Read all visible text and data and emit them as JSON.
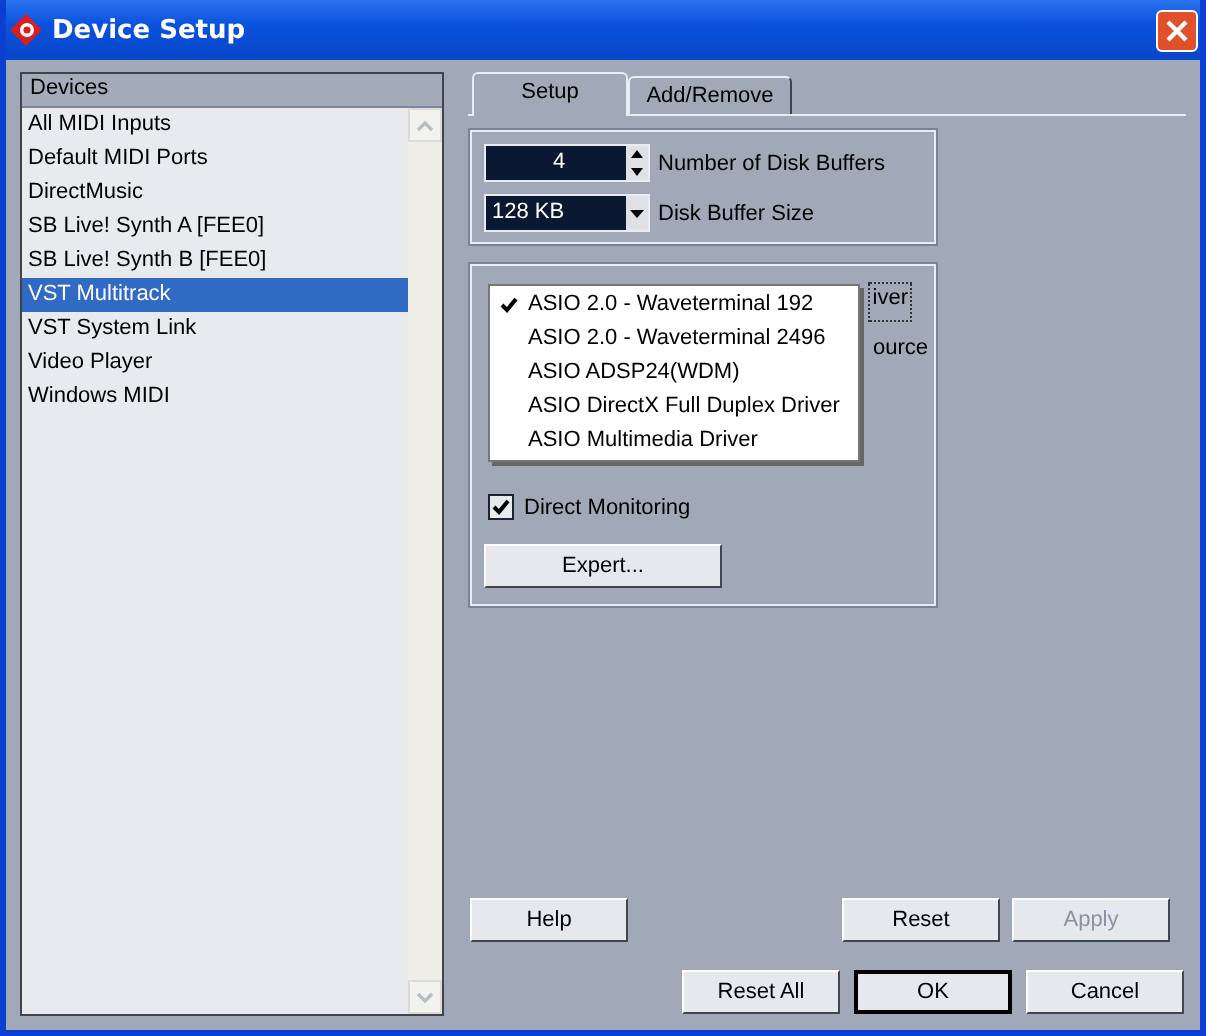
{
  "window": {
    "title": "Device Setup"
  },
  "devices": {
    "header": "Devices",
    "items": [
      {
        "label": "All MIDI Inputs",
        "selected": false
      },
      {
        "label": "Default MIDI Ports",
        "selected": false
      },
      {
        "label": "DirectMusic",
        "selected": false
      },
      {
        "label": "SB Live! Synth A [FEE0]",
        "selected": false
      },
      {
        "label": "SB Live! Synth B [FEE0]",
        "selected": false
      },
      {
        "label": "VST Multitrack",
        "selected": true
      },
      {
        "label": "VST System Link",
        "selected": false
      },
      {
        "label": "Video Player",
        "selected": false
      },
      {
        "label": "Windows MIDI",
        "selected": false
      }
    ]
  },
  "tabs": [
    {
      "label": "Setup",
      "selected": true
    },
    {
      "label": "Add/Remove",
      "selected": false
    }
  ],
  "disk_buffers": {
    "value": "4",
    "label": "Number of Disk Buffers"
  },
  "buffer_size": {
    "value": "128 KB",
    "label": "Disk Buffer Size"
  },
  "button_fragment": "iver",
  "label_fragment": "ource",
  "driver_menu": {
    "items": [
      {
        "label": "ASIO 2.0 - Waveterminal 192",
        "checked": true
      },
      {
        "label": "ASIO 2.0 - Waveterminal 2496",
        "checked": false
      },
      {
        "label": "ASIO ADSP24(WDM)",
        "checked": false
      },
      {
        "label": "ASIO DirectX Full Duplex Driver",
        "checked": false
      },
      {
        "label": "ASIO Multimedia Driver",
        "checked": false
      }
    ]
  },
  "direct_monitoring": {
    "label": "Direct Monitoring",
    "checked": true
  },
  "expert_button": "Expert...",
  "panel_buttons": [
    {
      "label": "Help",
      "disabled": false
    },
    {
      "label": "Reset",
      "disabled": false
    },
    {
      "label": "Apply",
      "disabled": true
    }
  ],
  "dialog_buttons": [
    {
      "label": "Reset All",
      "default": false
    },
    {
      "label": "OK",
      "default": true
    },
    {
      "label": "Cancel",
      "default": false
    }
  ]
}
